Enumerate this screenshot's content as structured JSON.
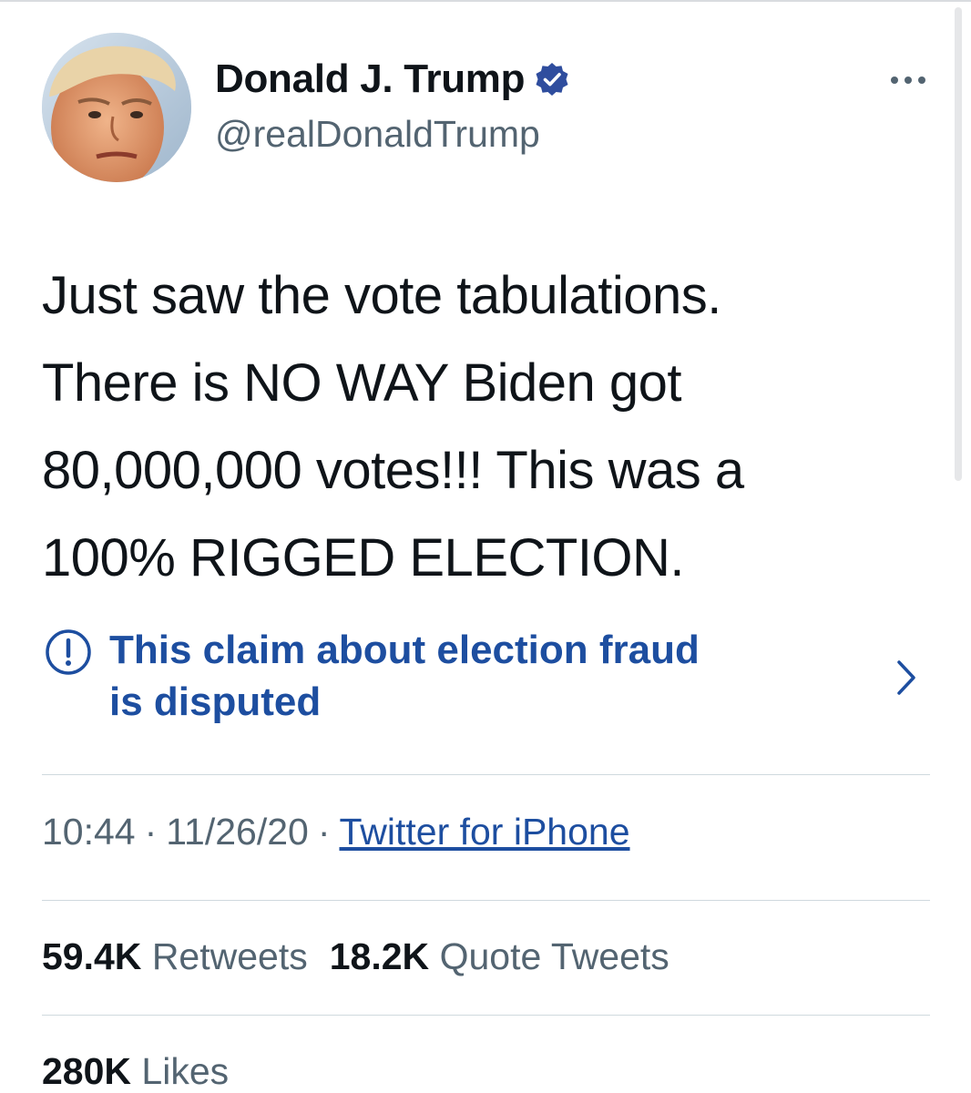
{
  "author": {
    "display_name": "Donald J. Trump",
    "handle": "@realDonaldTrump",
    "verified_icon": "verified-badge-icon",
    "avatar": "profile-photo"
  },
  "tweet": {
    "lines": [
      "Just saw the vote tabulations.",
      "There is NO WAY Biden got",
      "80,000,000 votes!!! This was a",
      "100% RIGGED ELECTION."
    ]
  },
  "notice": {
    "icon": "exclamation-circle-icon",
    "lines": [
      "This claim about election fraud",
      "is disputed"
    ],
    "chevron": "chevron-right-icon"
  },
  "meta": {
    "time": "10:44",
    "separator": "·",
    "date": "11/26/20",
    "source": "Twitter for iPhone"
  },
  "stats": {
    "retweets_count": "59.4K",
    "retweets_label": "Retweets",
    "quotes_count": "18.2K",
    "quotes_label": "Quote Tweets",
    "likes_count": "280K",
    "likes_label": "Likes"
  },
  "colors": {
    "text_primary": "#0f1419",
    "text_secondary": "#536471",
    "link_blue": "#1d4ea0",
    "verified_blue": "#2f4d9e",
    "divider": "#cfd9de"
  }
}
